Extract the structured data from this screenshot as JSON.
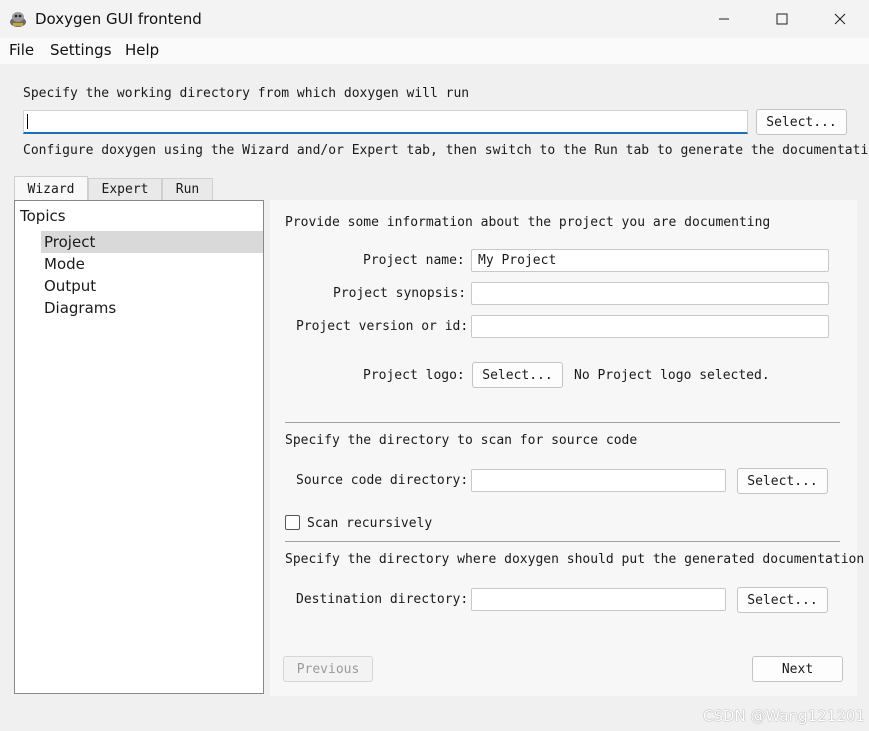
{
  "window": {
    "title": "Doxygen GUI frontend",
    "icons": {
      "app": "doxygen-app-icon",
      "minimize": "minimize-icon",
      "maximize": "maximize-icon",
      "close": "close-icon"
    }
  },
  "menu": {
    "file": "File",
    "settings": "Settings",
    "help": "Help"
  },
  "workdir": {
    "prompt": "Specify the working directory from which doxygen will run",
    "value": "",
    "select_label": "Select...",
    "hint": "Configure doxygen using the Wizard and/or Expert tab, then switch to the Run tab to generate the documentation"
  },
  "tabs": [
    {
      "label": "Wizard",
      "active": true
    },
    {
      "label": "Expert",
      "active": false
    },
    {
      "label": "Run",
      "active": false
    }
  ],
  "topics": {
    "header": "Topics",
    "items": [
      "Project",
      "Mode",
      "Output",
      "Diagrams"
    ],
    "selected": "Project"
  },
  "project": {
    "intro": "Provide some information about the project you are documenting",
    "name_label": "Project name:",
    "name_value": "My Project",
    "synopsis_label": "Project synopsis:",
    "synopsis_value": "",
    "version_label": "Project version or id:",
    "version_value": "",
    "logo_label": "Project logo:",
    "logo_select": "Select...",
    "logo_status": "No Project logo selected."
  },
  "source": {
    "intro": "Specify the directory to scan for source code",
    "dir_label": "Source code directory:",
    "dir_value": "",
    "select_label": "Select...",
    "recursive_label": "Scan recursively",
    "recursive_checked": false
  },
  "destination": {
    "intro": "Specify the directory where doxygen should put the generated documentation",
    "dir_label": "Destination directory:",
    "dir_value": "",
    "select_label": "Select..."
  },
  "nav": {
    "previous": "Previous",
    "next": "Next"
  },
  "watermark": "CSDN @Wang121201"
}
